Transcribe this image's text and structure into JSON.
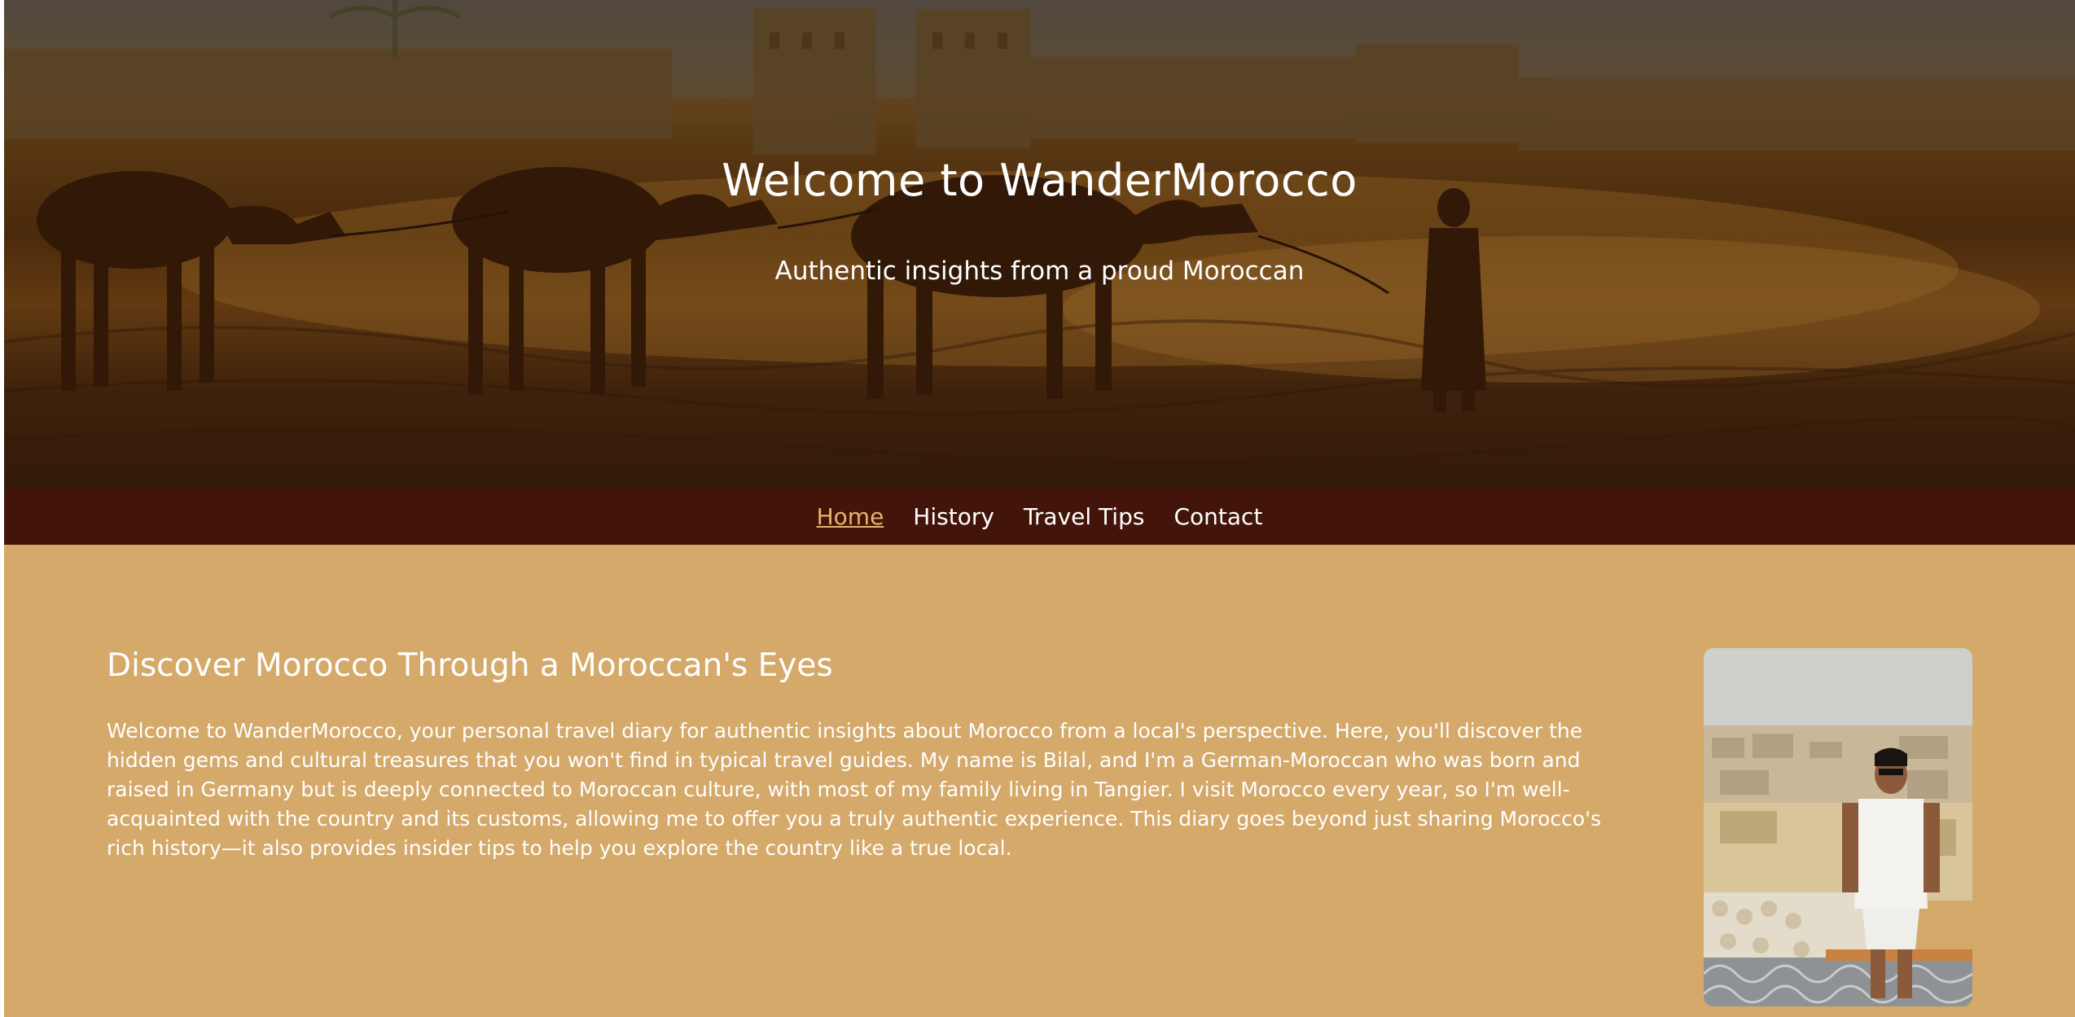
{
  "hero": {
    "title": "Welcome to WanderMorocco",
    "subtitle": "Authentic insights from a proud Moroccan"
  },
  "nav": {
    "items": [
      {
        "label": "Home",
        "active": true
      },
      {
        "label": "History",
        "active": false
      },
      {
        "label": "Travel Tips",
        "active": false
      },
      {
        "label": "Contact",
        "active": false
      }
    ]
  },
  "intro": {
    "heading": "Discover Morocco Through a Moroccan's Eyes",
    "text": "Welcome to WanderMorocco, your personal travel diary for authentic insights about Morocco from a local's perspective. Here, you'll discover the hidden gems and cultural treasures that you won't find in typical travel guides. My name is Bilal, and I'm a German-Moroccan who was born and raised in Germany but is deeply connected to Moroccan culture, with most of my family living in Tangier. I visit Morocco every year, so I'm well-acquainted with the country and its customs, allowing me to offer you a truly authentic experience. This diary goes beyond just sharing Morocco's rich history—it also provides insider tips to help you explore the country like a true local."
  },
  "colors": {
    "page_background": "#d4a96a",
    "navbar_background": "#43150a",
    "active_link": "#e6b36e",
    "text": "#ffffff"
  }
}
